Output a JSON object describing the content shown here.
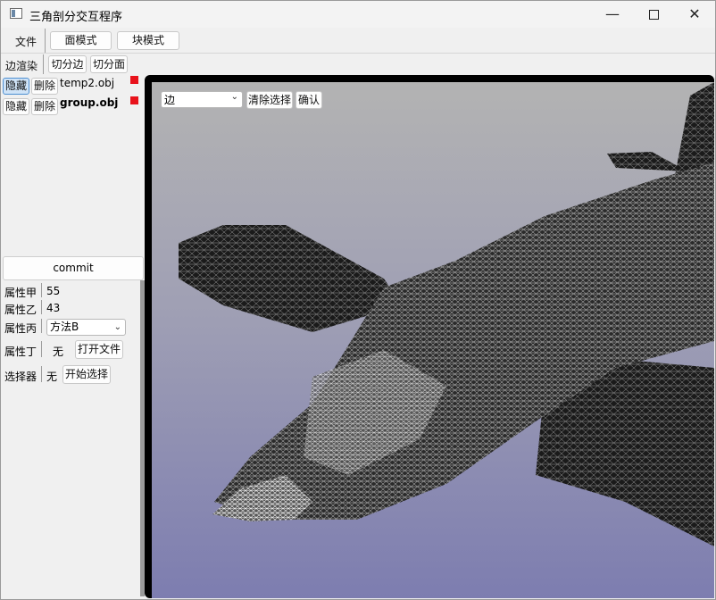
{
  "window": {
    "title": "三角剖分交互程序",
    "controls": {
      "minimize": "—",
      "close": "✕"
    }
  },
  "menubar": {
    "file": "文件",
    "face_mode": "面模式",
    "block_mode": "块模式"
  },
  "toolbar": {
    "edge_render": "边渲染",
    "cut_edge": "切分边",
    "cut_face": "切分面"
  },
  "objects": [
    {
      "hide": "隐藏",
      "delete": "删除",
      "name": "temp2.obj",
      "color": "#e8121b",
      "hide_active": true
    },
    {
      "hide": "隐藏",
      "delete": "删除",
      "name": "group.obj",
      "color": "#e8121b",
      "hide_active": false
    }
  ],
  "commit_label": "commit",
  "properties": {
    "prop_a": {
      "label": "属性甲",
      "value": "55"
    },
    "prop_b": {
      "label": "属性乙",
      "value": "43"
    },
    "prop_c": {
      "label": "属性丙",
      "value": "方法B"
    },
    "prop_d": {
      "label": "属性丁",
      "value": "无",
      "button": "打开文件"
    },
    "selector": {
      "label": "选择器",
      "value": "无",
      "button": "开始选择"
    }
  },
  "viewport": {
    "select_mode": "边",
    "clear_selection": "清除选择",
    "confirm": "确认"
  },
  "colors": {
    "accent_red": "#e8121b",
    "viewport_top": "#b3b3b3",
    "viewport_bottom": "#7d7db0"
  }
}
